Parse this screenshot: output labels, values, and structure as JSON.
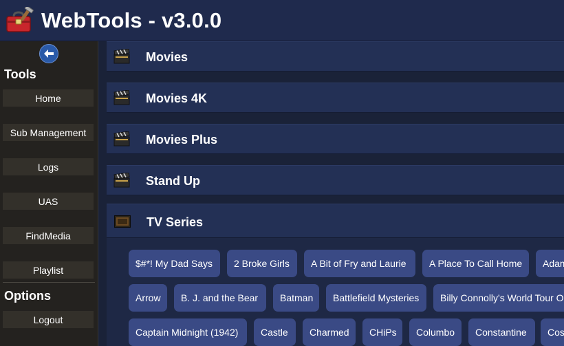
{
  "header": {
    "title": "WebTools - v3.0.0",
    "logo_icon": "toolbox-icon"
  },
  "sidebar": {
    "back_icon": "arrow-left-icon",
    "tools_heading": "Tools",
    "tools": [
      "Home",
      "Sub Management",
      "Logs",
      "UAS",
      "FindMedia",
      "Playlist"
    ],
    "options_heading": "Options",
    "options": [
      "Logout"
    ]
  },
  "main": {
    "categories": [
      {
        "label": "Movies",
        "icon": "clapperboard-icon"
      },
      {
        "label": "Movies 4K",
        "icon": "clapperboard-icon"
      },
      {
        "label": "Movies Plus",
        "icon": "clapperboard-icon"
      },
      {
        "label": "Stand Up",
        "icon": "clapperboard-icon"
      }
    ],
    "tv": {
      "label": "TV Series",
      "icon": "tv-icon",
      "shows": [
        [
          "$#*! My Dad Says",
          "2 Broke Girls",
          "A Bit of Fry and Laurie",
          "A Place To Call Home",
          "Adam"
        ],
        [
          "Arrow",
          "B. J. and the Bear",
          "Batman",
          "Battlefield Mysteries",
          "Billy Connolly's World Tour O"
        ],
        [
          "Captain Midnight (1942)",
          "Castle",
          "Charmed",
          "CHiPs",
          "Columbo",
          "Constantine",
          "Cos"
        ]
      ]
    }
  },
  "colors": {
    "chip": "#3a4a85",
    "header_bar": "#1f2a4d",
    "sidebar": "#24221f",
    "category_row": "#233055",
    "back_button": "#2a5aa8"
  }
}
